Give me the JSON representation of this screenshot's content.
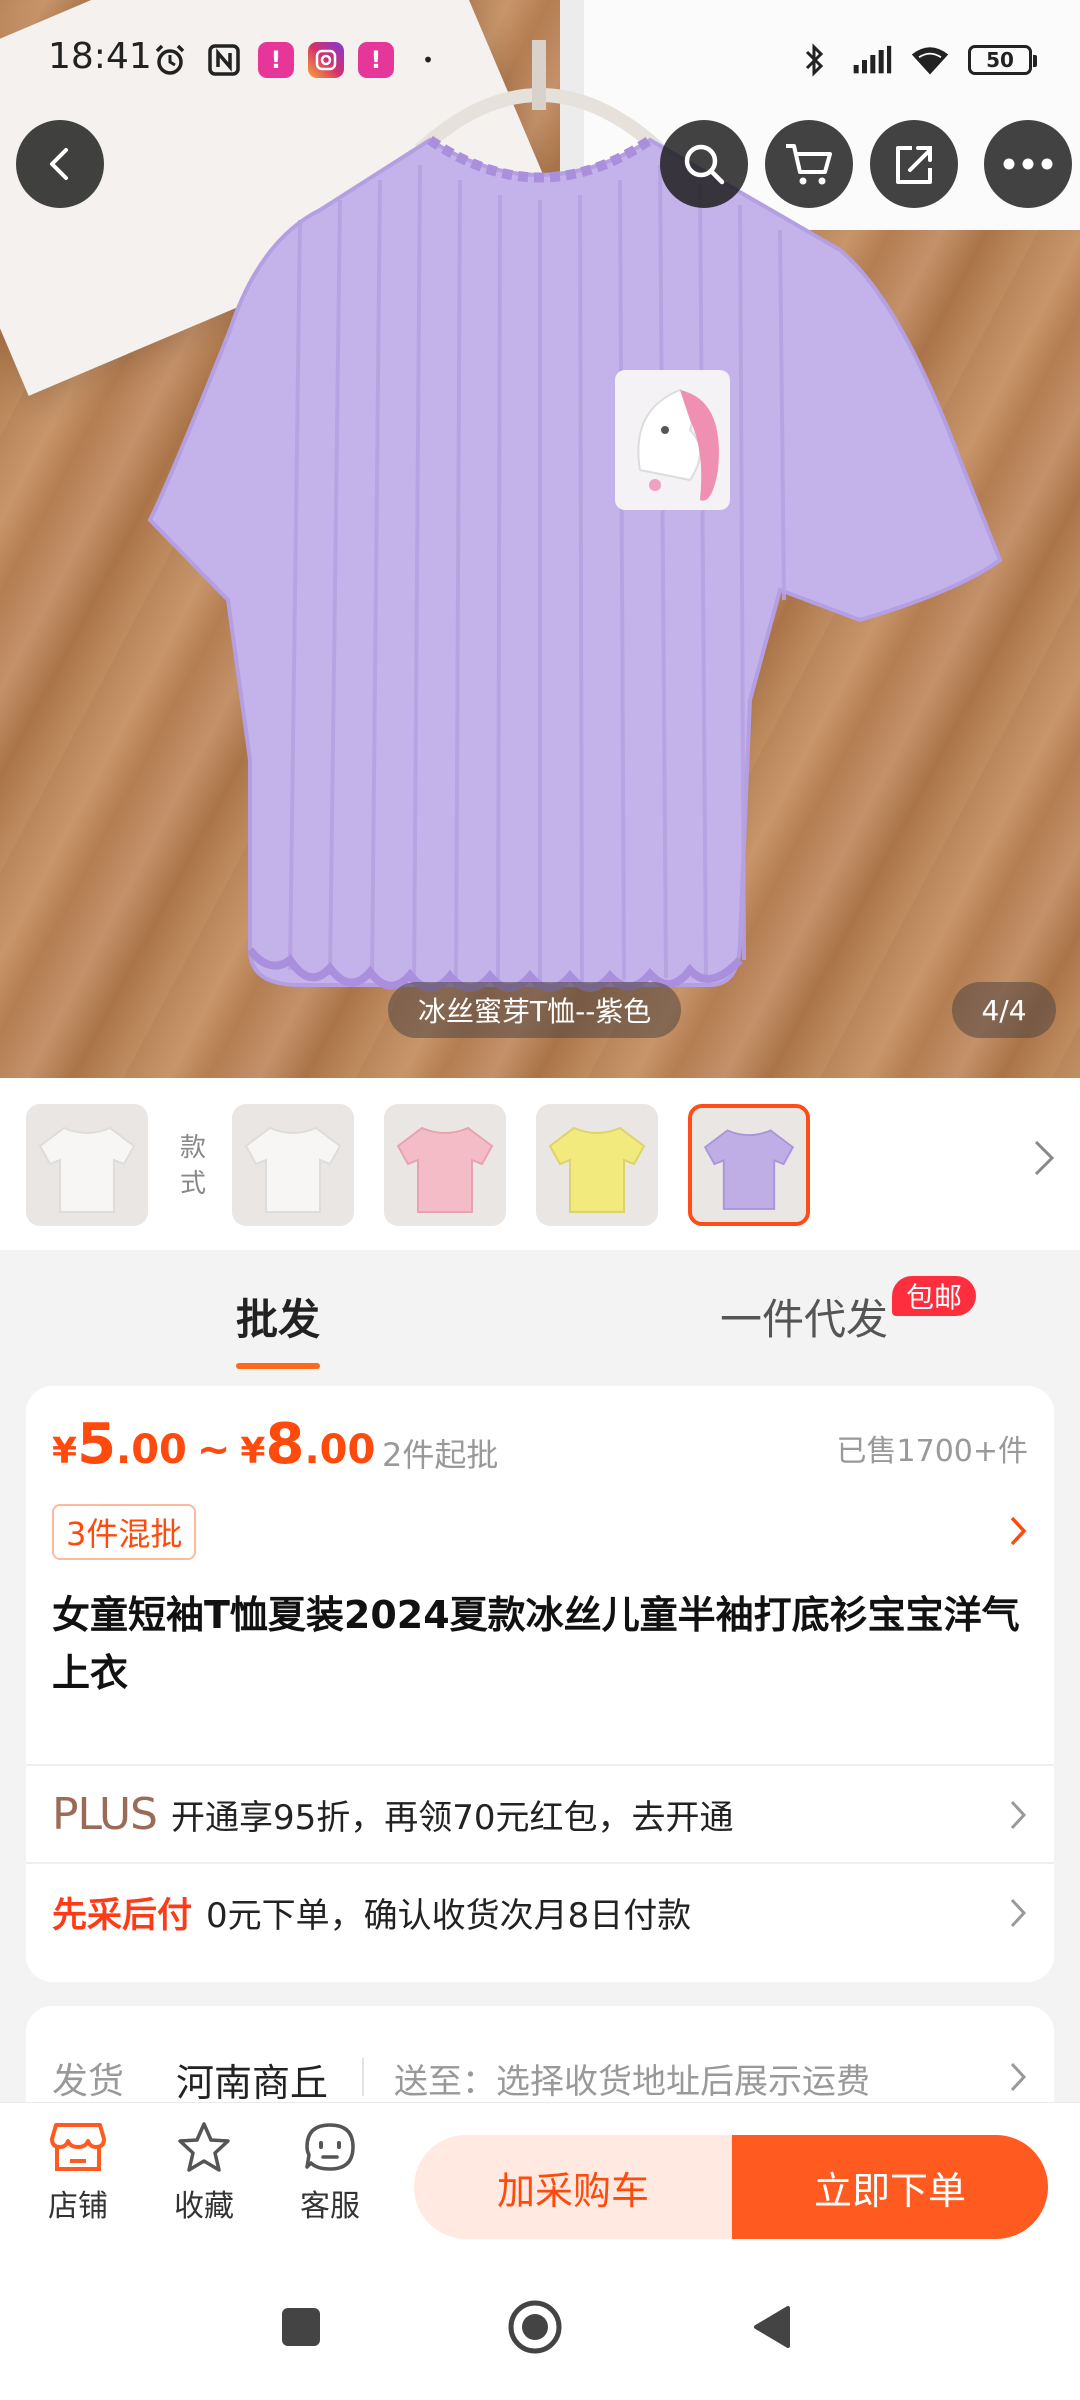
{
  "status_bar": {
    "time": "18:41",
    "battery": "50",
    "app_icons": [
      "alarm-icon",
      "nfc-icon",
      "app-icon",
      "instagram-icon",
      "app-icon",
      "dot-icon"
    ],
    "right_icons": [
      "bluetooth-icon",
      "signal-icon",
      "wifi-icon",
      "battery-icon"
    ]
  },
  "gallery": {
    "caption": "冰丝蜜芽T恤--紫色",
    "counter": "4/4",
    "thumbnail_label": "款式",
    "thumbnail_colors": [
      "#f2f0ee",
      "#f2f0ee",
      "#f4bcc6",
      "#f2ea7c",
      "#bfaee6"
    ],
    "active_thumbnail": 4
  },
  "tabs": {
    "wholesale": "批发",
    "dropship": "一件代发",
    "dropship_badge": "包邮"
  },
  "product": {
    "currency": "¥",
    "price_low_int": "5",
    "price_low_dec": ".00",
    "tilde": "~",
    "price_high_int": "8",
    "price_high_dec": ".00",
    "min_order": "2件起批",
    "sold": "已售1700+件",
    "mix_tag": "3件混批",
    "title": "女童短袖T恤夏装2024夏款冰丝儿童半袖打底衫宝宝洋气上衣",
    "plus_logo": "PLUS",
    "plus_text": "开通享95折，再领70元红包，去开通",
    "pay_logo": "先采后付",
    "pay_text": "0元下单，确认收货次月8日付款"
  },
  "shipping": {
    "label": "发货",
    "origin": "河南商丘",
    "destination": "送至：选择收货地址后展示运费"
  },
  "actions": {
    "store": "店铺",
    "favorite": "收藏",
    "service": "客服",
    "add_cart": "加采购车",
    "order_now": "立即下单"
  },
  "colors": {
    "accent": "#ff5a1f",
    "price": "#ff4a0d",
    "badge": "#ff2e3e",
    "shirt": "#c4b2ea"
  }
}
